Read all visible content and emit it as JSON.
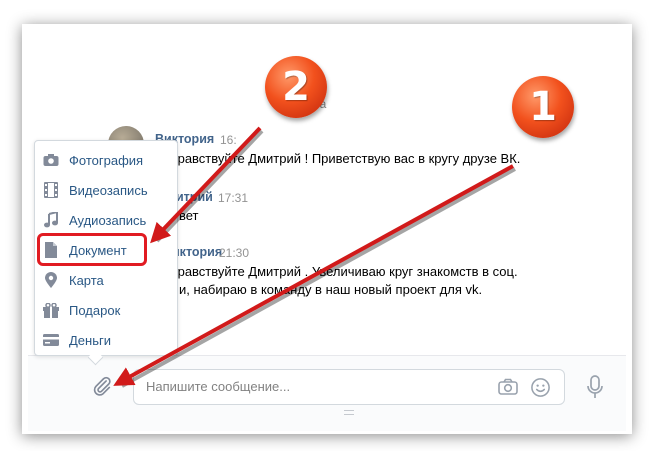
{
  "chat": {
    "date_separator": "чера",
    "messages": [
      {
        "author": "Виктория",
        "time": "16:",
        "text": "дравствуйте Дмитрий ! Приветствую вас в кругу друзе ВК."
      },
      {
        "author": "итрий",
        "time": "17:31",
        "text": "вет"
      },
      {
        "author": "иктория",
        "time": "21:30",
        "text_line1": "дравствуйте Дмитрий . Увеличиваю круг знакомств в соц.",
        "text_line2": "и, набираю в команду в наш новый проект для vk."
      }
    ]
  },
  "attach_menu": {
    "items": [
      {
        "label": "Фотография",
        "icon": "camera-icon"
      },
      {
        "label": "Видеозапись",
        "icon": "film-icon"
      },
      {
        "label": "Аудиозапись",
        "icon": "music-note-icon"
      },
      {
        "label": "Документ",
        "icon": "document-icon"
      },
      {
        "label": "Карта",
        "icon": "map-pin-icon"
      },
      {
        "label": "Подарок",
        "icon": "gift-icon"
      },
      {
        "label": "Деньги",
        "icon": "card-icon"
      }
    ]
  },
  "composer": {
    "placeholder": "Напишите сообщение...",
    "attach_icon": "paperclip-icon",
    "camera_icon": "camera-icon",
    "emoji_icon": "smile-icon",
    "mic_icon": "microphone-icon"
  },
  "annotations": {
    "badge_1": "1",
    "badge_2": "2",
    "arrow_color": "#d11a1a",
    "badge_color": "#f2511d"
  }
}
